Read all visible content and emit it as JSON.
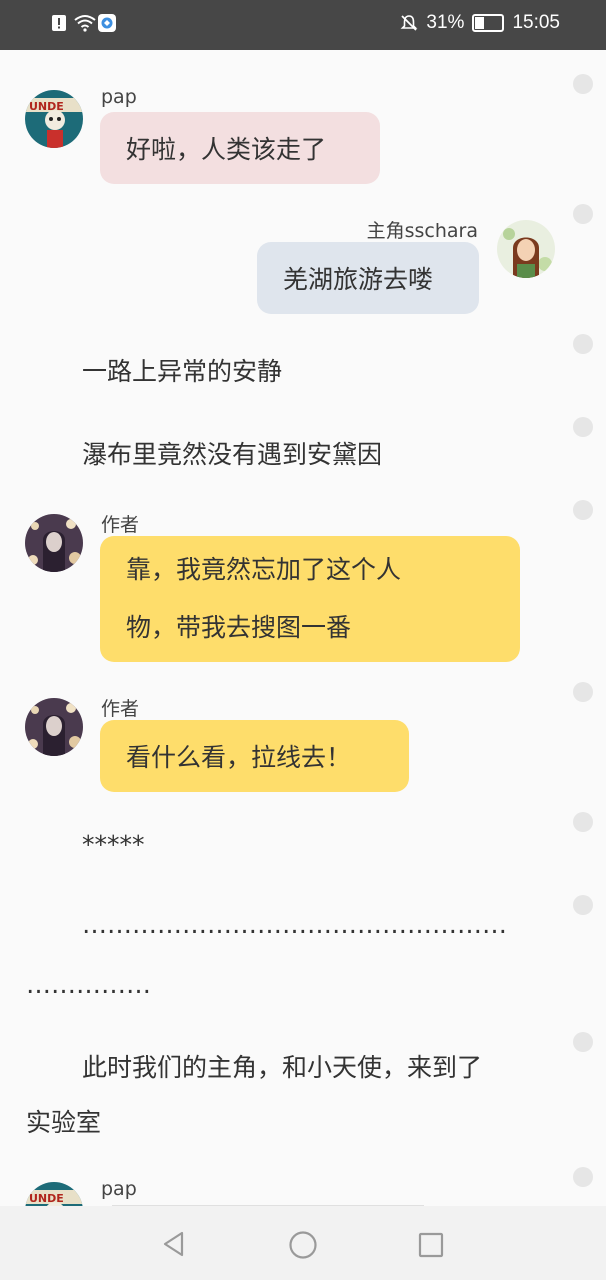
{
  "status_bar": {
    "battery": "31%",
    "battery_level": 0.31,
    "time": "15:05"
  },
  "chat": [
    {
      "type": "message",
      "side": "left",
      "name": "pap",
      "avatar": "papyrus-avatar",
      "text": "好啦，人类该走了",
      "color": "#f3dfe0"
    },
    {
      "type": "message",
      "side": "right",
      "name": "主角sschara",
      "avatar": "chara-avatar",
      "text": "羌湖旅游去喽",
      "color": "#dfe5ed"
    },
    {
      "type": "narration",
      "text": "一路上异常的安静"
    },
    {
      "type": "narration",
      "text": "瀑布里竟然没有遇到安黛因"
    },
    {
      "type": "message",
      "side": "left",
      "name": "作者",
      "avatar": "author-avatar",
      "lines": [
        "靠，我竟然忘加了这个人",
        "物，带我去搜图一番"
      ],
      "color": "#fedd6b"
    },
    {
      "type": "message",
      "side": "left",
      "name": "作者",
      "avatar": "author-avatar",
      "text": "看什么看，拉线去！",
      "color": "#fedd6b"
    },
    {
      "type": "narration",
      "text": "*****"
    },
    {
      "type": "narration",
      "lines": [
        "……………………………………………",
        "……………"
      ]
    },
    {
      "type": "narration",
      "lines": [
        "此时我们的主角，和小天使，来到了",
        "实验室"
      ]
    },
    {
      "type": "message",
      "side": "left",
      "name": "pap",
      "avatar": "papyrus-avatar"
    }
  ],
  "colors": {
    "status_bar_bg": "#474747",
    "page_bg": "#fafafa",
    "nav_bg": "#f2f2f2"
  }
}
